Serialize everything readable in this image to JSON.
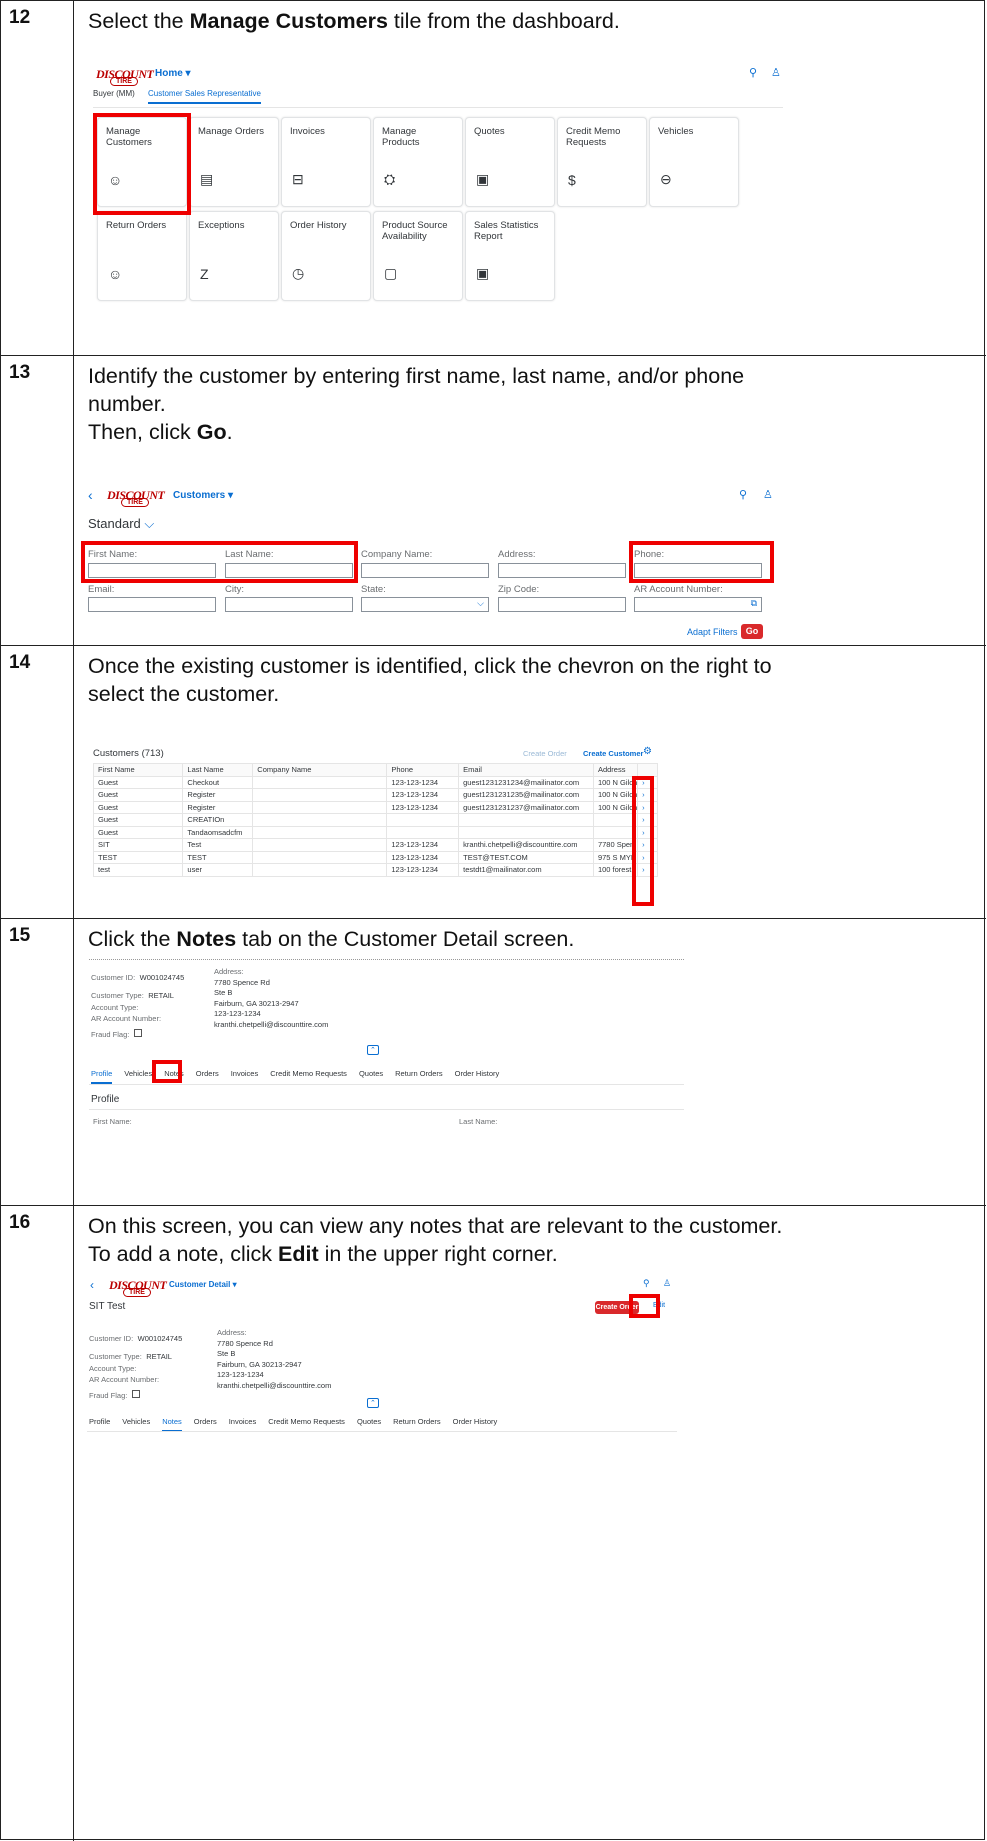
{
  "steps": [
    {
      "number": "12",
      "pre": "Select the ",
      "bold": "Manage Customers",
      "post": " tile from the dashboard."
    },
    {
      "number": "13",
      "line1": "Identify the customer by entering first name, last name, and/or phone",
      "line2": "number.",
      "line3_pre": "Then, click ",
      "line3_bold": "Go",
      "line3_post": "."
    },
    {
      "number": "14",
      "line1": "Once the existing customer is identified, click the chevron on the right to",
      "line2": "select the customer."
    },
    {
      "number": "15",
      "pre": "Click the ",
      "bold": "Notes",
      "post": " tab on the Customer Detail screen."
    },
    {
      "number": "16",
      "line1": "On this screen, you can view any notes that are relevant to the customer.",
      "line2_pre": "To add a note, click ",
      "line2_bold": "Edit",
      "line2_post": " in the upper right corner."
    }
  ],
  "brand": {
    "logo_top": "DISCOUNT",
    "logo_bottom": "TIRE"
  },
  "dashboard": {
    "nav_title": "Home ▾",
    "tabs": [
      "Buyer (MM)",
      "Customer Sales Representative"
    ],
    "tiles_row1": [
      {
        "label": "Manage Customers",
        "icon": "☺"
      },
      {
        "label": "Manage Orders",
        "icon": "▤"
      },
      {
        "label": "Invoices",
        "icon": "⊟"
      },
      {
        "label": "Manage Products",
        "icon": "⛭"
      },
      {
        "label": "Quotes",
        "icon": "▣"
      },
      {
        "label": "Credit Memo Requests",
        "icon": "$"
      },
      {
        "label": "Vehicles",
        "icon": "⊖"
      }
    ],
    "tiles_row2": [
      {
        "label": "Return Orders",
        "icon": "☺"
      },
      {
        "label": "Exceptions",
        "icon": "Z"
      },
      {
        "label": "Order History",
        "icon": "◷"
      },
      {
        "label": "Product Source Availability",
        "icon": "▢"
      },
      {
        "label": "Sales Statistics Report",
        "icon": "▣"
      }
    ]
  },
  "search": {
    "nav_title": "Customers ▾",
    "variant": "Standard",
    "fields_row1": [
      "First Name:",
      "Last Name:",
      "Company Name:",
      "Address:",
      "Phone:"
    ],
    "fields_row2": [
      "Email:",
      "City:",
      "State:",
      "Zip Code:",
      "AR Account Number:"
    ],
    "adapt_filters": "Adapt Filters",
    "go": "Go"
  },
  "results": {
    "title": "Customers (713)",
    "create_order": "Create Order",
    "create_customer": "Create Customer",
    "columns": [
      "First Name",
      "Last Name",
      "Company Name",
      "Phone",
      "Email",
      "Address"
    ],
    "rows": [
      [
        "Guest",
        "Checkout",
        "",
        "123-123-1234",
        "guest1231231234@mailinator.com",
        "100 N Gilch"
      ],
      [
        "Guest",
        "Register",
        "",
        "123-123-1234",
        "guest1231231235@mailinator.com",
        "100 N Gilch"
      ],
      [
        "Guest",
        "Register",
        "",
        "123-123-1234",
        "guest1231231237@mailinator.com",
        "100 N Gilch"
      ],
      [
        "Guest",
        "CREATIOn",
        "",
        "",
        "",
        ""
      ],
      [
        "Guest",
        "Tandaomsadcfm",
        "",
        "",
        "",
        ""
      ],
      [
        "SIT",
        "Test",
        "",
        "123-123-1234",
        "kranthi.chetpelli@discounttire.com",
        "7780 Spen"
      ],
      [
        "TEST",
        "TEST",
        "",
        "123-123-1234",
        "TEST@TEST.COM",
        "975 S MYR"
      ],
      [
        "test",
        "user",
        "",
        "123-123-1234",
        "testdt1@mailinator.com",
        "100 forest"
      ]
    ]
  },
  "detail": {
    "nav_title": "Customer Detail ▾",
    "name": "SIT Test",
    "create_order": "Create Order",
    "edit": "Edit",
    "customer_id_label": "Customer ID:",
    "customer_id": "W001024745",
    "customer_type_label": "Customer Type:",
    "customer_type": "RETAIL",
    "account_type_label": "Account Type:",
    "ar_label": "AR Account Number:",
    "fraud_label": "Fraud Flag:",
    "address_label": "Address:",
    "address_lines": [
      "7780 Spence Rd",
      "Ste B",
      "Fairburn, GA 30213-2947",
      "123-123-1234",
      "kranthi.chetpelli@discounttire.com"
    ],
    "tabs": [
      "Profile",
      "Vehicles",
      "Notes",
      "Orders",
      "Invoices",
      "Credit Memo Requests",
      "Quotes",
      "Return Orders",
      "Order History"
    ],
    "section_title": "Profile",
    "first_name_label": "First Name:",
    "last_name_label": "Last Name:"
  }
}
